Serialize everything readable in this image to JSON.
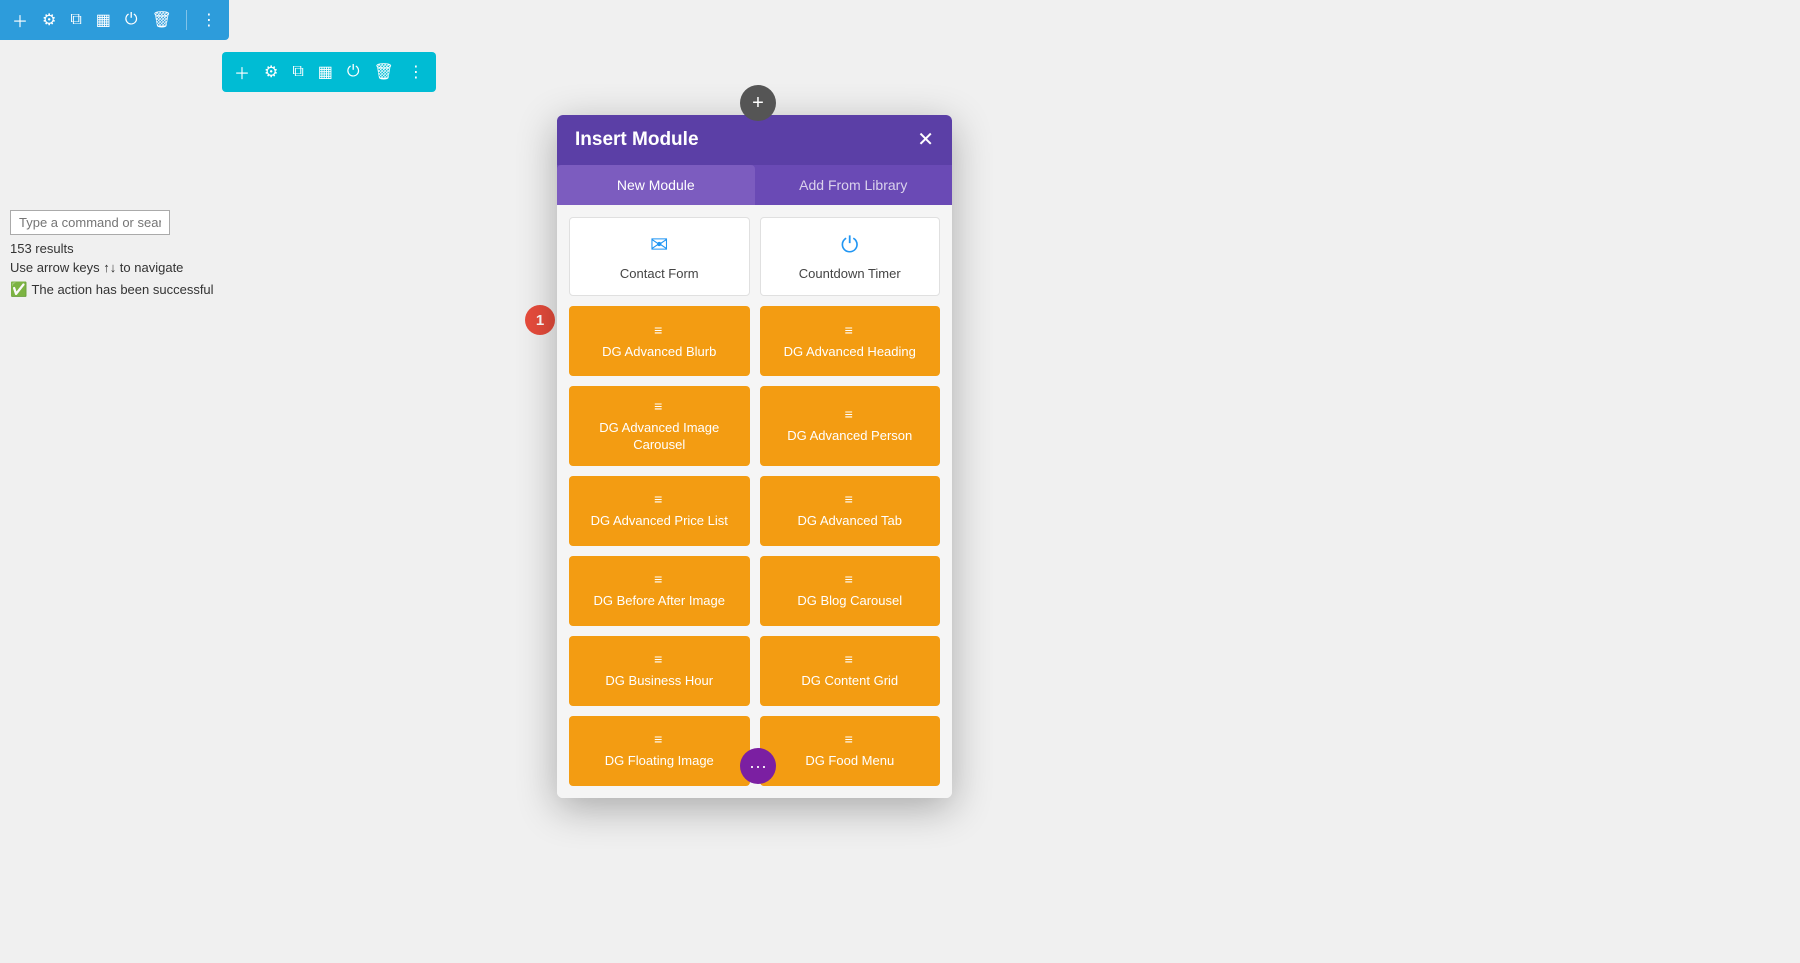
{
  "top_toolbar": {
    "icons": [
      "plus",
      "gear",
      "clone",
      "grid",
      "power",
      "trash",
      "dots"
    ]
  },
  "row_toolbar": {
    "icons": [
      "plus",
      "gear",
      "clone",
      "grid",
      "power",
      "trash",
      "dots"
    ]
  },
  "left_panel": {
    "search_placeholder": "Type a command or sear",
    "results_count": "153 results",
    "nav_hint": "Use arrow keys ↑↓ to navigate",
    "success_message": "The action has been successful"
  },
  "step_badge": "1",
  "modal": {
    "title": "Insert Module",
    "tabs": [
      {
        "label": "New Module",
        "active": true
      },
      {
        "label": "Add From Library",
        "active": false
      }
    ],
    "white_cards": [
      {
        "icon": "envelope",
        "label": "Contact Form"
      },
      {
        "icon": "clock",
        "label": "Countdown Timer"
      }
    ],
    "orange_cards": [
      {
        "label": "DG Advanced Blurb"
      },
      {
        "label": "DG Advanced Heading"
      },
      {
        "label": "DG Advanced Image Carousel"
      },
      {
        "label": "DG Advanced Person"
      },
      {
        "label": "DG Advanced Price List"
      },
      {
        "label": "DG Advanced Tab"
      },
      {
        "label": "DG Before After Image"
      },
      {
        "label": "DG Blog Carousel"
      },
      {
        "label": "DG Business Hour"
      },
      {
        "label": "DG Content Grid"
      },
      {
        "label": "DG Floating Image"
      },
      {
        "label": "DG Food Menu"
      }
    ]
  },
  "plus_btn_top": "+",
  "plus_btn_bottom": "···"
}
